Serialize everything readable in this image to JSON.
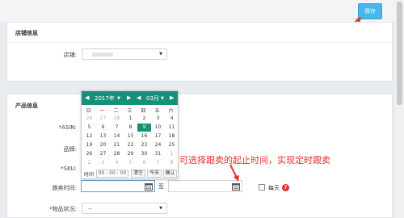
{
  "toolbar": {
    "save_label": "保存"
  },
  "store": {
    "title": "店铺信息",
    "store_label": "店铺:",
    "store_value": ""
  },
  "product": {
    "title": "产品信息",
    "asin_label": "*ASIN:",
    "brand_label": "品牌:",
    "sku_label": "*SKU:",
    "follow_time_label": "跟卖时间:",
    "to_label": "至",
    "daily_label": "每天",
    "condition_label": "*物品状况:",
    "condition_value": "--"
  },
  "calendar": {
    "year": "2017年",
    "month": "03月",
    "weekdays": [
      "日",
      "一",
      "二",
      "三",
      "四",
      "五",
      "六"
    ],
    "weeks": [
      [
        "26",
        "27",
        "28",
        "1",
        "2",
        "3",
        "4"
      ],
      [
        "5",
        "6",
        "7",
        "8",
        "9",
        "10",
        "11"
      ],
      [
        "12",
        "13",
        "14",
        "15",
        "16",
        "17",
        "18"
      ],
      [
        "19",
        "20",
        "21",
        "22",
        "23",
        "24",
        "25"
      ],
      [
        "26",
        "27",
        "28",
        "29",
        "30",
        "31",
        "1"
      ],
      [
        "2",
        "3",
        "4",
        "5",
        "6",
        "7",
        "8"
      ]
    ],
    "selected_day": "9",
    "time_label": "时间",
    "time_value": "00 : 00 : 00",
    "clear_label": "清空",
    "today_label": "今天",
    "confirm_label": "确认"
  },
  "annotation": {
    "text": "可选择跟卖的起止时间，实现定时跟卖"
  },
  "colors": {
    "accent": "#16907a",
    "save": "#48b6e6",
    "annotation": "#e5322a"
  }
}
